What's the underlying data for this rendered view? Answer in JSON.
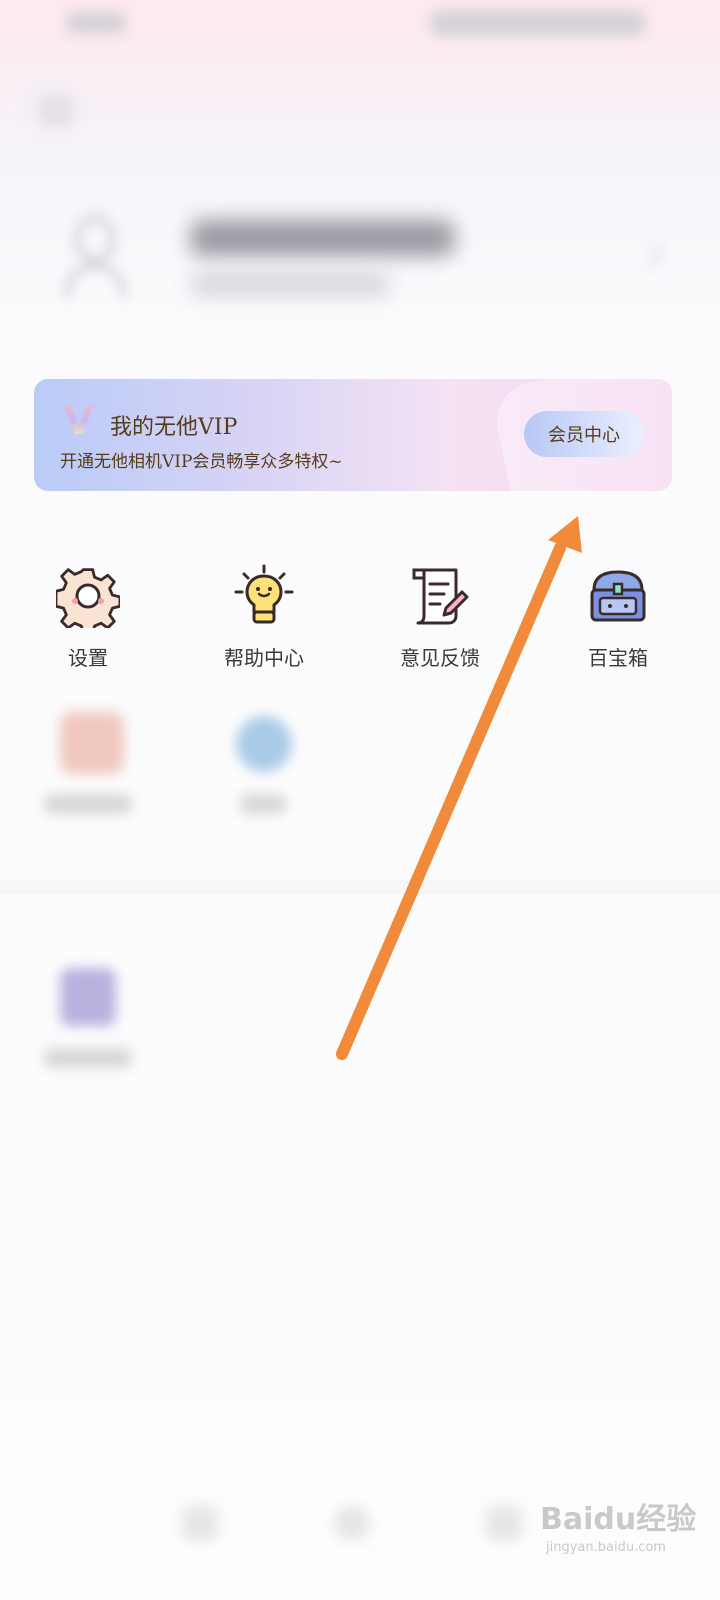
{
  "vip": {
    "logo_letter": "V",
    "title": "我的无他VIP",
    "subtitle": "开通无他相机VIP会员畅享众多特权~",
    "button_label": "会员中心"
  },
  "grid": {
    "items": [
      {
        "label": "设置",
        "icon": "gear-icon"
      },
      {
        "label": "帮助中心",
        "icon": "lightbulb-icon"
      },
      {
        "label": "意见反馈",
        "icon": "feedback-scroll-icon"
      },
      {
        "label": "百宝箱",
        "icon": "treasure-chest-icon"
      }
    ]
  },
  "annotation": {
    "color": "#f28a3c"
  },
  "watermark": {
    "main": "Baidu经验",
    "sub": "jingyan.baidu.com"
  }
}
